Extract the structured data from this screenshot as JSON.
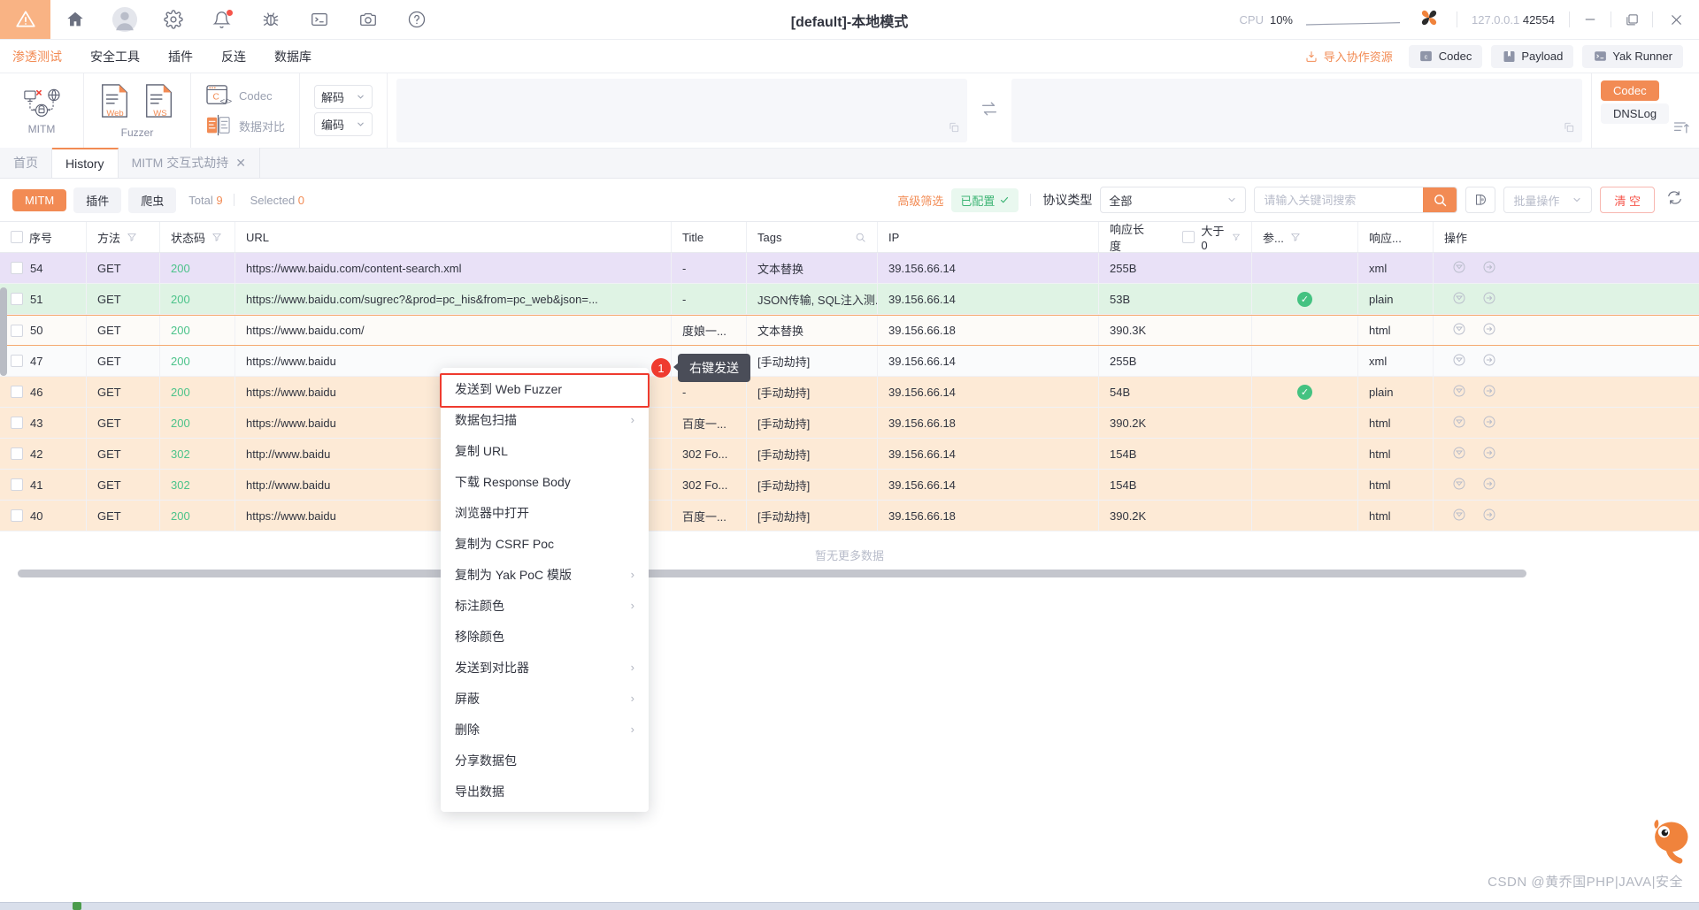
{
  "titlebar": {
    "app_icon": "warning-triangle-icon",
    "icons": [
      "home-icon",
      "user-avatar-icon",
      "gear-icon",
      "bell-icon",
      "bug-icon",
      "terminal-icon",
      "camera-icon",
      "help-icon"
    ],
    "title": "[default]-本地模式",
    "cpu_label": "CPU",
    "cpu_value": "10%",
    "ip": "127.0.0.1",
    "port": "42554",
    "minimize": "—",
    "maximize": "❐",
    "close": "✕"
  },
  "menubar": {
    "items": [
      {
        "label": "渗透测试",
        "active": true
      },
      {
        "label": "安全工具",
        "active": false
      },
      {
        "label": "插件",
        "active": false
      },
      {
        "label": "反连",
        "active": false
      },
      {
        "label": "数据库",
        "active": false
      }
    ],
    "import_label": "导入协作资源",
    "quick": [
      {
        "label": "Codec",
        "icon": "codec-icon"
      },
      {
        "label": "Payload",
        "icon": "book-icon"
      },
      {
        "label": "Yak Runner",
        "icon": "terminal-icon"
      }
    ]
  },
  "ribbon": {
    "mitm_label": "MITM",
    "fuzzer_label": "Fuzzer",
    "fuzzer_web": "Web",
    "fuzzer_ws": "WS",
    "codec_label": "Codec",
    "compare_label": "数据对比",
    "decode_label": "解码",
    "encode_label": "编码",
    "right_tabs": [
      {
        "label": "Codec",
        "active": true
      },
      {
        "label": "DNSLog",
        "active": false
      }
    ]
  },
  "tabs": [
    {
      "label": "首页",
      "active": false,
      "closable": false
    },
    {
      "label": "History",
      "active": true,
      "closable": false
    },
    {
      "label": "MITM 交互式劫持",
      "active": false,
      "closable": true
    }
  ],
  "filterbar": {
    "segments": [
      {
        "label": "MITM",
        "active": true
      },
      {
        "label": "插件",
        "active": false
      },
      {
        "label": "爬虫",
        "active": false
      }
    ],
    "total_label": "Total",
    "total_value": "9",
    "selected_label": "Selected",
    "selected_value": "0",
    "advanced_filter": "高级筛选",
    "configured_badge": "已配置",
    "protocol_label": "协议类型",
    "protocol_value": "全部",
    "search_placeholder": "请输入关键词搜索",
    "search_value": "",
    "batch_label": "批量操作",
    "clear_label": "清 空",
    "color_icon": "color-marker-icon",
    "refresh_icon": "refresh-icon",
    "search_icon": "search-icon"
  },
  "table": {
    "headers": {
      "index": "序号",
      "method": "方法",
      "status": "状态码",
      "url": "URL",
      "title": "Title",
      "tags": "Tags",
      "ip": "IP",
      "length": "响应长度",
      "greater_than": "大于0",
      "params": "参...",
      "response": "响应...",
      "actions": "操作"
    },
    "rows": [
      {
        "idx": "54",
        "method": "GET",
        "status": "200",
        "url": "https://www.baidu.com/content-search.xml",
        "title": "-",
        "tags": "文本替换",
        "ip": "39.156.66.14",
        "length": "255B",
        "param": "",
        "resp": "xml",
        "color": "purple"
      },
      {
        "idx": "51",
        "method": "GET",
        "status": "200",
        "url": "https://www.baidu.com/sugrec?&prod=pc_his&from=pc_web&json=...",
        "title": "-",
        "tags": "JSON传输, SQL注入测...",
        "ip": "39.156.66.14",
        "length": "53B",
        "param": "check",
        "resp": "plain",
        "color": "green"
      },
      {
        "idx": "50",
        "method": "GET",
        "status": "200",
        "url": "https://www.baidu.com/",
        "title": "度娘一...",
        "tags": "文本替换",
        "ip": "39.156.66.18",
        "length": "390.3K",
        "param": "",
        "resp": "html",
        "color": "selected"
      },
      {
        "idx": "47",
        "method": "GET",
        "status": "200",
        "url": "https://www.baidu",
        "title": "-",
        "tags": "[手动劫持]",
        "ip": "39.156.66.14",
        "length": "255B",
        "param": "",
        "resp": "xml",
        "color": "plain"
      },
      {
        "idx": "46",
        "method": "GET",
        "status": "200",
        "url": "https://www.baidu",
        "title": "-",
        "tags": "[手动劫持]",
        "ip": "39.156.66.14",
        "length": "54B",
        "param": "check",
        "resp": "plain",
        "color": "peach"
      },
      {
        "idx": "43",
        "method": "GET",
        "status": "200",
        "url": "https://www.baidu",
        "title": "百度一...",
        "tags": "[手动劫持]",
        "ip": "39.156.66.18",
        "length": "390.2K",
        "param": "",
        "resp": "html",
        "color": "peach"
      },
      {
        "idx": "42",
        "method": "GET",
        "status": "302",
        "url": "http://www.baidu",
        "title": "302 Fo...",
        "tags": "[手动劫持]",
        "ip": "39.156.66.14",
        "length": "154B",
        "param": "",
        "resp": "html",
        "color": "peach"
      },
      {
        "idx": "41",
        "method": "GET",
        "status": "302",
        "url": "http://www.baidu",
        "title": "302 Fo...",
        "tags": "[手动劫持]",
        "ip": "39.156.66.14",
        "length": "154B",
        "param": "",
        "resp": "html",
        "color": "peach"
      },
      {
        "idx": "40",
        "method": "GET",
        "status": "200",
        "url": "https://www.baidu",
        "title": "百度一...",
        "tags": "[手动劫持]",
        "ip": "39.156.66.18",
        "length": "390.2K",
        "param": "",
        "resp": "html",
        "color": "peach"
      }
    ],
    "no_more": "暂无更多数据"
  },
  "context_menu": {
    "items": [
      {
        "label": "发送到 Web Fuzzer",
        "submenu": false,
        "highlighted": true
      },
      {
        "label": "数据包扫描",
        "submenu": true,
        "highlighted": false
      },
      {
        "label": "复制 URL",
        "submenu": false,
        "highlighted": false
      },
      {
        "label": "下载 Response Body",
        "submenu": false,
        "highlighted": false
      },
      {
        "label": "浏览器中打开",
        "submenu": false,
        "highlighted": false
      },
      {
        "label": "复制为 CSRF Poc",
        "submenu": false,
        "highlighted": false
      },
      {
        "label": "复制为 Yak PoC 模版",
        "submenu": true,
        "highlighted": false
      },
      {
        "label": "标注颜色",
        "submenu": true,
        "highlighted": false
      },
      {
        "label": "移除颜色",
        "submenu": false,
        "highlighted": false
      },
      {
        "label": "发送到对比器",
        "submenu": true,
        "highlighted": false
      },
      {
        "label": "屏蔽",
        "submenu": true,
        "highlighted": false
      },
      {
        "label": "删除",
        "submenu": true,
        "highlighted": false
      },
      {
        "label": "分享数据包",
        "submenu": false,
        "highlighted": false
      },
      {
        "label": "导出数据",
        "submenu": false,
        "highlighted": false
      }
    ]
  },
  "annotation": {
    "step_number": "1",
    "tooltip": "右键发送"
  },
  "footer": {
    "watermark": "CSDN @黄乔国PHP|JAVA|安全"
  },
  "colors": {
    "accent": "#f28b54",
    "danger": "#f6544a",
    "success": "#44c281",
    "row_purple": "#e9e1f7",
    "row_green": "#dff3e4",
    "row_peach": "#fdead6"
  }
}
